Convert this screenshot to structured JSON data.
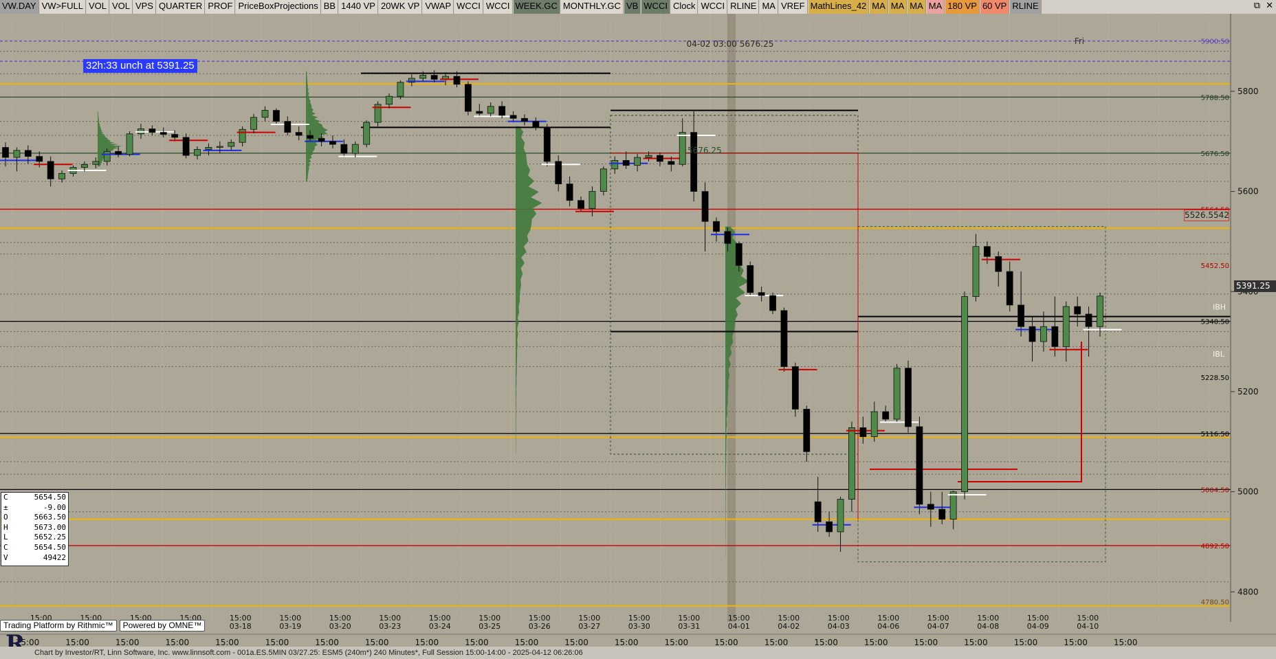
{
  "toolbar": {
    "buttons": [
      {
        "label": "VW.DAY",
        "style": "gray"
      },
      {
        "label": "VW>FULL",
        "style": ""
      },
      {
        "label": "VOL",
        "style": ""
      },
      {
        "label": "VOL",
        "style": ""
      },
      {
        "label": "VPS",
        "style": ""
      },
      {
        "label": "QUARTER",
        "style": ""
      },
      {
        "label": "PROF",
        "style": ""
      },
      {
        "label": "PriceBoxProjections",
        "style": ""
      },
      {
        "label": "BB",
        "style": ""
      },
      {
        "label": "1440 VP",
        "style": ""
      },
      {
        "label": "20WK VP",
        "style": ""
      },
      {
        "label": "VWAP",
        "style": ""
      },
      {
        "label": "WCCI",
        "style": ""
      },
      {
        "label": "WCCI",
        "style": ""
      },
      {
        "label": "WEEK.GC",
        "style": "dark"
      },
      {
        "label": "MONTHLY.GC",
        "style": ""
      },
      {
        "label": "VB",
        "style": "dark"
      },
      {
        "label": "WCCI",
        "style": "dark"
      },
      {
        "label": "Clock",
        "style": ""
      },
      {
        "label": "WCCI",
        "style": ""
      },
      {
        "label": "RLINE",
        "style": ""
      },
      {
        "label": "MA",
        "style": ""
      },
      {
        "label": "VREF",
        "style": ""
      },
      {
        "label": "MathLines_42",
        "style": "gold"
      },
      {
        "label": "MA",
        "style": "gold"
      },
      {
        "label": "MA",
        "style": "gold"
      },
      {
        "label": "MA",
        "style": "gold"
      },
      {
        "label": "MA",
        "style": "pink"
      },
      {
        "label": "180 VP",
        "style": "orange"
      },
      {
        "label": "60 VP",
        "style": "salmon"
      },
      {
        "label": "RLINE",
        "style": "gray"
      }
    ],
    "window_controls": [
      "⧉",
      "✕"
    ]
  },
  "chart_header": {
    "crosshair_label": "04-02 03:00  5676.25",
    "day_label": "Fri",
    "timer_label": "32h:33  unch at 5391.25",
    "ibh_label": "IBH",
    "ibl_label": "IBL",
    "last_price": "5391.25",
    "ref_price": "5526.5542",
    "inline_price": "5676.25"
  },
  "ohlc": [
    {
      "k": "C",
      "v": "5654.50"
    },
    {
      "k": "±",
      "v": "-9.00"
    },
    {
      "k": "O",
      "v": "5663.50"
    },
    {
      "k": "H",
      "v": "5673.00"
    },
    {
      "k": "L",
      "v": "5652.25"
    },
    {
      "k": "C",
      "v": "5654.50"
    },
    {
      "k": "V",
      "v": "49422"
    }
  ],
  "branding": {
    "rithmic": "Trading Platform by Rithmic™",
    "omne": "Powered by OMNE™",
    "logo": "R",
    "footer": "Chart by Investor/RT, Linn Software, Inc. www.linnsoft.com - 001a.ES.5MIN   03/27.25: ESM5 (240m*) 240 Minutes*, Full Session 15:00-14:00 - 2025-04-12 06:26:06"
  },
  "colors": {
    "background": "#aca796",
    "bull": "#4f8a4a",
    "bear": "#000000",
    "red_line": "#cc0000",
    "orange_line": "#f0b400",
    "blue_line": "#1c2ee6",
    "profile": "#3f7a3c"
  },
  "chart_data": {
    "type": "candlestick",
    "title": "",
    "ylim": [
      4740,
      5955
    ],
    "y_ticks": [
      5800,
      5600,
      5400,
      5200,
      5000,
      4800
    ],
    "right_labels": [
      {
        "value": 5900.5,
        "text": "5900.50",
        "color": "#5a3ac0"
      },
      {
        "value": 5788.5,
        "text": "5788.50",
        "color": "#1e3a1e"
      },
      {
        "value": 5676.5,
        "text": "5676.50",
        "color": "#1e3a1e"
      },
      {
        "value": 5564.5,
        "text": "5564.50",
        "color": "#b00000"
      },
      {
        "value": 5452.5,
        "text": "5452.50",
        "color": "#b00000"
      },
      {
        "value": 5340.5,
        "text": "5340.50",
        "color": "#000"
      },
      {
        "value": 5228.5,
        "text": "5228.50",
        "color": "#000"
      },
      {
        "value": 5116.5,
        "text": "5116.50",
        "color": "#000"
      },
      {
        "value": 5004.5,
        "text": "5004.50",
        "color": "#b00000"
      },
      {
        "value": 4892.5,
        "text": "4892.50",
        "color": "#b00000"
      },
      {
        "value": 4780.5,
        "text": "4780.50",
        "color": "#7a4a00"
      }
    ],
    "horizontal_lines": [
      {
        "value": 5900.5,
        "color": "#6a4ac8",
        "style": "dashed"
      },
      {
        "value": 5860,
        "color": "#6a4ac8",
        "style": "dashed"
      },
      {
        "value": 5815,
        "color": "#f0b400",
        "style": "solid"
      },
      {
        "value": 5788.5,
        "color": "#2a4a2a",
        "style": "solid"
      },
      {
        "value": 5676.5,
        "color": "#2a4a2a",
        "style": "solid"
      },
      {
        "value": 5564.5,
        "color": "#cc0000",
        "style": "solid"
      },
      {
        "value": 5526.5,
        "color": "#f0b400",
        "style": "solid"
      },
      {
        "value": 5340.5,
        "color": "#000000",
        "style": "solid"
      },
      {
        "value": 5116.5,
        "color": "#000000",
        "style": "solid"
      },
      {
        "value": 5109,
        "color": "#f0b400",
        "style": "solid"
      },
      {
        "value": 5004.5,
        "color": "#000000",
        "style": "solid"
      },
      {
        "value": 4945,
        "color": "#f0b400",
        "style": "solid"
      },
      {
        "value": 4892.5,
        "color": "#cc0000",
        "style": "solid"
      },
      {
        "value": 4772,
        "color": "#f0b400",
        "style": "solid"
      }
    ],
    "x_ticks": [
      {
        "top": "15:00",
        "bottom": "",
        "i": 0.3
      },
      {
        "top": "15:00",
        "bottom": "",
        "i": 1.3
      },
      {
        "top": "15:00",
        "bottom": "",
        "i": 2.3
      },
      {
        "top": "15:00",
        "bottom": "",
        "i": 3.3
      },
      {
        "top": "15:00",
        "bottom": "03-18",
        "i": 4.3
      },
      {
        "top": "15:00",
        "bottom": "03-19",
        "i": 5.3
      },
      {
        "top": "15:00",
        "bottom": "03-20",
        "i": 6.3
      },
      {
        "top": "15:00",
        "bottom": "03-23",
        "i": 7.3
      },
      {
        "top": "15:00",
        "bottom": "03-24",
        "i": 8.3
      },
      {
        "top": "15:00",
        "bottom": "03-25",
        "i": 9.3
      },
      {
        "top": "15:00",
        "bottom": "03-26",
        "i": 10.3
      },
      {
        "top": "15:00",
        "bottom": "03-27",
        "i": 11.3
      },
      {
        "top": "15:00",
        "bottom": "03-30",
        "i": 12.3
      },
      {
        "top": "15:00",
        "bottom": "03-31",
        "i": 13.3
      },
      {
        "top": "15:00",
        "bottom": "04-01",
        "i": 14.3
      },
      {
        "top": "15:00",
        "bottom": "04-02",
        "i": 15.3
      },
      {
        "top": "15:00",
        "bottom": "04-03",
        "i": 16.3
      },
      {
        "top": "15:00",
        "bottom": "04-06",
        "i": 17.3
      },
      {
        "top": "15:00",
        "bottom": "04-07",
        "i": 18.3
      },
      {
        "top": "15:00",
        "bottom": "04-08",
        "i": 19.3
      },
      {
        "top": "15:00",
        "bottom": "04-09",
        "i": 20.3
      },
      {
        "top": "15:00",
        "bottom": "04-10",
        "i": 21.3
      }
    ],
    "bottom_axis_labels": [
      "15:00",
      "15:00",
      "15:00",
      "15:00",
      "15:00",
      "15:00",
      "15:00",
      "15:00",
      "15:00",
      "15:00",
      "15:00",
      "15:00",
      "15:00",
      "15:00",
      "15:00",
      "15:00",
      "15:00",
      "15:00",
      "15:00",
      "15:00",
      "15:00",
      "15:00",
      "15:00"
    ],
    "candles": [
      [
        5688,
        5698,
        5650,
        5668
      ],
      [
        5668,
        5688,
        5640,
        5682
      ],
      [
        5682,
        5692,
        5655,
        5670
      ],
      [
        5670,
        5680,
        5648,
        5660
      ],
      [
        5660,
        5670,
        5610,
        5625
      ],
      [
        5625,
        5642,
        5618,
        5636
      ],
      [
        5636,
        5652,
        5630,
        5648
      ],
      [
        5648,
        5660,
        5640,
        5654
      ],
      [
        5654,
        5668,
        5646,
        5660
      ],
      [
        5660,
        5686,
        5652,
        5680
      ],
      [
        5680,
        5690,
        5668,
        5674
      ],
      [
        5674,
        5720,
        5670,
        5715
      ],
      [
        5715,
        5735,
        5705,
        5725
      ],
      [
        5725,
        5732,
        5712,
        5718
      ],
      [
        5718,
        5728,
        5708,
        5714
      ],
      [
        5714,
        5722,
        5700,
        5708
      ],
      [
        5708,
        5716,
        5666,
        5672
      ],
      [
        5672,
        5690,
        5664,
        5684
      ],
      [
        5684,
        5696,
        5672,
        5688
      ],
      [
        5688,
        5700,
        5676,
        5690
      ],
      [
        5690,
        5704,
        5682,
        5698
      ],
      [
        5698,
        5730,
        5690,
        5724
      ],
      [
        5724,
        5755,
        5716,
        5748
      ],
      [
        5748,
        5770,
        5740,
        5762
      ],
      [
        5762,
        5766,
        5734,
        5740
      ],
      [
        5740,
        5750,
        5712,
        5718
      ],
      [
        5718,
        5730,
        5702,
        5712
      ],
      [
        5712,
        5722,
        5700,
        5706
      ],
      [
        5706,
        5716,
        5690,
        5700
      ],
      [
        5700,
        5712,
        5686,
        5694
      ],
      [
        5694,
        5704,
        5668,
        5676
      ],
      [
        5676,
        5700,
        5668,
        5694
      ],
      [
        5694,
        5742,
        5688,
        5738
      ],
      [
        5738,
        5780,
        5730,
        5774
      ],
      [
        5774,
        5796,
        5766,
        5790
      ],
      [
        5790,
        5822,
        5784,
        5818
      ],
      [
        5818,
        5834,
        5810,
        5826
      ],
      [
        5826,
        5840,
        5820,
        5832
      ],
      [
        5832,
        5842,
        5818,
        5824
      ],
      [
        5824,
        5838,
        5812,
        5830
      ],
      [
        5830,
        5840,
        5808,
        5814
      ],
      [
        5814,
        5820,
        5752,
        5760
      ],
      [
        5760,
        5775,
        5748,
        5756
      ],
      [
        5756,
        5778,
        5750,
        5770
      ],
      [
        5770,
        5780,
        5746,
        5752
      ],
      [
        5752,
        5760,
        5738,
        5746
      ],
      [
        5746,
        5754,
        5732,
        5740
      ],
      [
        5740,
        5748,
        5722,
        5728
      ],
      [
        5728,
        5735,
        5650,
        5660
      ],
      [
        5660,
        5672,
        5600,
        5615
      ],
      [
        5615,
        5630,
        5570,
        5582
      ],
      [
        5582,
        5590,
        5560,
        5566
      ],
      [
        5566,
        5610,
        5550,
        5600
      ],
      [
        5600,
        5650,
        5592,
        5645
      ],
      [
        5645,
        5670,
        5635,
        5662
      ],
      [
        5662,
        5680,
        5645,
        5652
      ],
      [
        5652,
        5675,
        5640,
        5668
      ],
      [
        5668,
        5680,
        5660,
        5672
      ],
      [
        5672,
        5678,
        5650,
        5660
      ],
      [
        5660,
        5670,
        5640,
        5654
      ],
      [
        5654,
        5746,
        5650,
        5718
      ],
      [
        5718,
        5760,
        5580,
        5600
      ],
      [
        5600,
        5618,
        5480,
        5540
      ],
      [
        5540,
        5548,
        5500,
        5520
      ],
      [
        5520,
        5528,
        5480,
        5496
      ],
      [
        5496,
        5500,
        5440,
        5452
      ],
      [
        5452,
        5460,
        5390,
        5398
      ],
      [
        5398,
        5410,
        5380,
        5392
      ],
      [
        5392,
        5398,
        5355,
        5362
      ],
      [
        5362,
        5368,
        5240,
        5250
      ],
      [
        5250,
        5258,
        5150,
        5165
      ],
      [
        5165,
        5172,
        5060,
        5080
      ],
      [
        4980,
        5030,
        4920,
        4940
      ],
      [
        4940,
        4960,
        4910,
        4920
      ],
      [
        4920,
        4990,
        4880,
        4985
      ],
      [
        4985,
        5140,
        4960,
        5128
      ],
      [
        5128,
        5150,
        5096,
        5110
      ],
      [
        5110,
        5180,
        5100,
        5160
      ],
      [
        5160,
        5172,
        5138,
        5145
      ],
      [
        5145,
        5255,
        5140,
        5247
      ],
      [
        5247,
        5262,
        5118,
        5130
      ],
      [
        5130,
        5150,
        4955,
        4975
      ],
      [
        4975,
        5000,
        4930,
        4965
      ],
      [
        4965,
        5000,
        4935,
        4945
      ],
      [
        4945,
        5002,
        4925,
        5000
      ],
      [
        5000,
        5400,
        4985,
        5390
      ],
      [
        5390,
        5515,
        5380,
        5490
      ],
      [
        5490,
        5500,
        5455,
        5470
      ],
      [
        5470,
        5480,
        5410,
        5440
      ],
      [
        5440,
        5460,
        5360,
        5373
      ],
      [
        5373,
        5440,
        5310,
        5330
      ],
      [
        5330,
        5350,
        5260,
        5300
      ],
      [
        5300,
        5360,
        5280,
        5330
      ],
      [
        5330,
        5390,
        5270,
        5290
      ],
      [
        5290,
        5380,
        5260,
        5370
      ],
      [
        5370,
        5390,
        5330,
        5355
      ],
      [
        5355,
        5370,
        5270,
        5330
      ],
      [
        5330,
        5398,
        5310,
        5391
      ]
    ],
    "volume_profiles": [
      {
        "x0": 142,
        "x1": 180,
        "ymax": 5760,
        "ymin": 5650,
        "peak": 5690
      },
      {
        "x0": 445,
        "x1": 482,
        "ymax": 5840,
        "ymin": 5620,
        "peak": 5720
      },
      {
        "x0": 750,
        "x1": 790,
        "ymax": 5730,
        "ymin": 5075,
        "peak": 5580
      },
      {
        "x0": 1055,
        "x1": 1090,
        "ymax": 5530,
        "ymin": 4870,
        "peak": 5420
      }
    ]
  }
}
